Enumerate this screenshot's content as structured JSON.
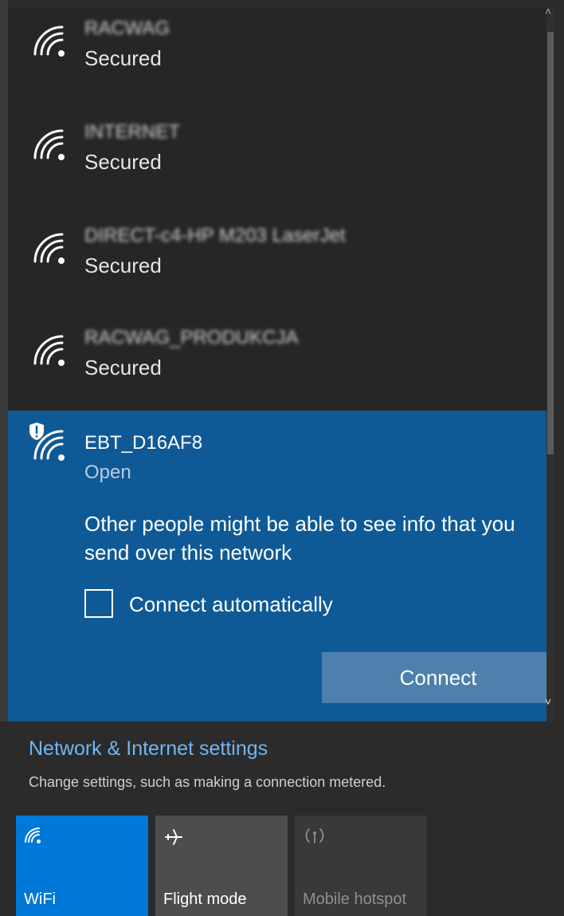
{
  "networks": [
    {
      "ssid": "RACWAG",
      "status": "Secured"
    },
    {
      "ssid": "INTERNET",
      "status": "Secured"
    },
    {
      "ssid": "DIRECT-c4-HP M203 LaserJet",
      "status": "Secured"
    },
    {
      "ssid": "RACWAG_PRODUKCJA",
      "status": "Secured"
    }
  ],
  "selected": {
    "ssid": "EBT_D16AF8",
    "status": "Open",
    "warning": "Other people might be able to see info that you send over this network",
    "auto_label": "Connect automatically",
    "auto_checked": false,
    "connect_label": "Connect"
  },
  "settings": {
    "title": "Network & Internet settings",
    "subtitle": "Change settings, such as making a connection metered."
  },
  "quick_actions": [
    {
      "label": "WiFi",
      "icon": "wifi-icon",
      "state": "on"
    },
    {
      "label": "Flight mode",
      "icon": "airplane-icon",
      "state": "off"
    },
    {
      "label": "Mobile hotspot",
      "icon": "hotspot-icon",
      "state": "disabled"
    }
  ],
  "colors": {
    "selected_bg": "#0f5a96",
    "accent": "#0078d7",
    "link": "#6fb5f2",
    "connect_button": "#4e80ad"
  }
}
